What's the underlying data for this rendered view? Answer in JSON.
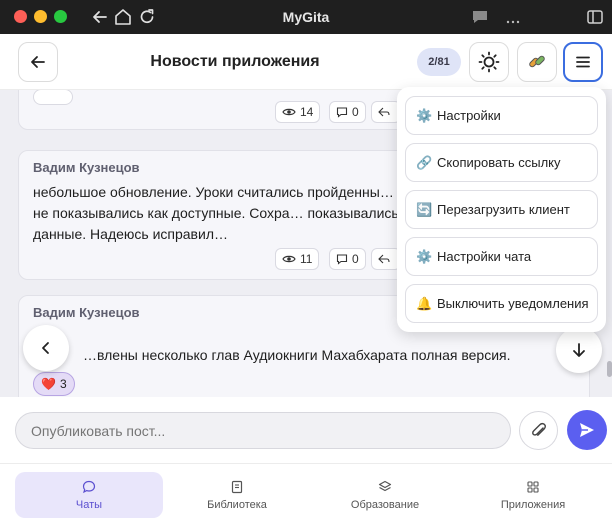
{
  "window": {
    "title": "MyGita"
  },
  "header": {
    "title": "Новости приложения",
    "counter": "2/81"
  },
  "posts": [
    {
      "views": "14",
      "comments": "0"
    },
    {
      "author": "Вадим Кузнецов",
      "text": "небольшое обновление. Уроки считались пройденны… но следующие не показывались как доступные. Сохра… показывались старые данные.  Надеюсь исправил…",
      "views": "11",
      "comments": "0"
    },
    {
      "author": "Вадим Кузнецов",
      "text": "…влены несколько глав Аудиокниги Махабхарата полная версия.",
      "reaction": {
        "emoji": "❤️",
        "count": "3"
      }
    }
  ],
  "menu": {
    "items": [
      {
        "icon": "⚙️",
        "label": "Настройки"
      },
      {
        "icon": "🔗",
        "label": "Скопировать ссылку"
      },
      {
        "icon": "🔄",
        "label": "Перезагрузить клиент"
      },
      {
        "icon": "⚙️",
        "label": "Настройки чата"
      },
      {
        "icon": "🔔",
        "label": "Выключить уведомления"
      }
    ]
  },
  "composer": {
    "placeholder": "Опубликовать пост..."
  },
  "nav": {
    "items": [
      {
        "label": "Чаты",
        "icon": "chat-bubble-icon",
        "active": true
      },
      {
        "label": "Библиотека",
        "icon": "book-icon"
      },
      {
        "label": "Образование",
        "icon": "layers-icon"
      },
      {
        "label": "Приложения",
        "icon": "grid-icon"
      }
    ]
  },
  "colors": {
    "accent": "#5b5ff0",
    "active_tab_bg": "#e9e6fb",
    "counter_bg": "#dfe4f7"
  }
}
